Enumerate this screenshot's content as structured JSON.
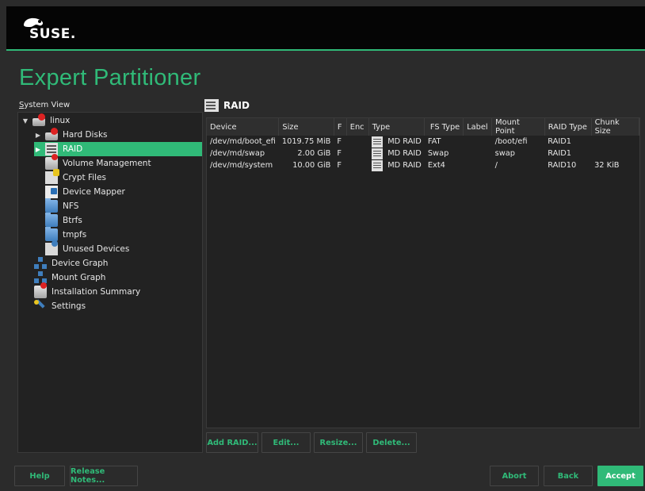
{
  "branding": {
    "logo_text": "SUSE."
  },
  "title": "Expert Partitioner",
  "system_view": {
    "label": "System View"
  },
  "tree": {
    "items": [
      {
        "label": "linux",
        "arrow": "▼"
      },
      {
        "label": "Hard Disks",
        "arrow": "▶"
      },
      {
        "label": "RAID",
        "arrow": "▶"
      },
      {
        "label": "Volume Management"
      },
      {
        "label": "Crypt Files"
      },
      {
        "label": "Device Mapper"
      },
      {
        "label": "NFS"
      },
      {
        "label": "Btrfs"
      },
      {
        "label": "tmpfs"
      },
      {
        "label": "Unused Devices"
      },
      {
        "label": "Device Graph"
      },
      {
        "label": "Mount Graph"
      },
      {
        "label": "Installation Summary"
      },
      {
        "label": "Settings"
      }
    ]
  },
  "panel": {
    "title": "RAID"
  },
  "table": {
    "headers": [
      "Device",
      "Size",
      "F",
      "Enc",
      "Type",
      "FS Type",
      "Label",
      "Mount Point",
      "RAID Type",
      "Chunk Size"
    ],
    "rows": [
      {
        "device": "/dev/md/boot_efi",
        "size": "1019.75 MiB",
        "f": "F",
        "enc": "",
        "type": "MD RAID",
        "fs_type": "FAT",
        "label": "",
        "mount": "/boot/efi",
        "raid_type": "RAID1",
        "chunk": ""
      },
      {
        "device": "/dev/md/swap",
        "size": "2.00 GiB",
        "f": "F",
        "enc": "",
        "type": "MD RAID",
        "fs_type": "Swap",
        "label": "",
        "mount": "swap",
        "raid_type": "RAID1",
        "chunk": ""
      },
      {
        "device": "/dev/md/system",
        "size": "10.00 GiB",
        "f": "F",
        "enc": "",
        "type": "MD RAID",
        "fs_type": "Ext4",
        "label": "",
        "mount": "/",
        "raid_type": "RAID10",
        "chunk": "32 KiB"
      }
    ]
  },
  "actions": {
    "add": "Add RAID...",
    "edit": "Edit...",
    "resize": "Resize...",
    "delete": "Delete..."
  },
  "footer": {
    "help": "Help",
    "release_notes": "Release Notes...",
    "abort": "Abort",
    "back": "Back",
    "accept": "Accept"
  },
  "colors": {
    "accent": "#30ba78",
    "background": "#2b2b2b",
    "header": "#050505"
  }
}
